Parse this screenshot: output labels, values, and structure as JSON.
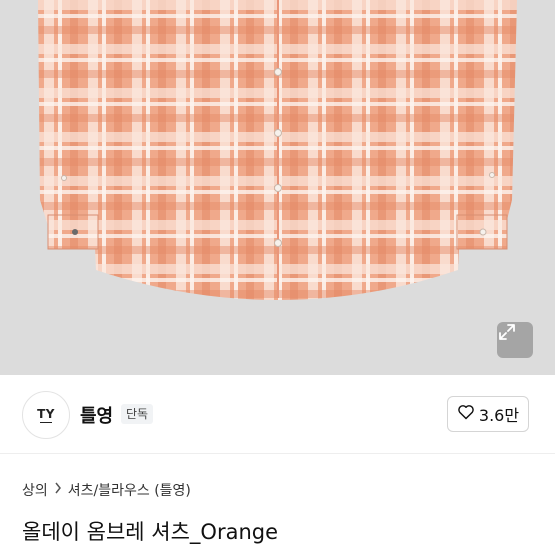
{
  "product": {
    "image_alt": "orange plaid shirt",
    "colors": {
      "base": "#f0a98b",
      "stripe_light": "#fbe7dd",
      "stripe_dark": "#e48a66",
      "background": "#dcdcdc"
    }
  },
  "seller": {
    "avatar_text": "TY",
    "name": "틀영",
    "badge": "단독"
  },
  "like": {
    "count": "3.6만"
  },
  "breadcrumb": {
    "category": "상의",
    "subcategory": "셔츠/블라우스 (틀영)"
  },
  "title": "올데이 옴브레 셔츠_Orange"
}
